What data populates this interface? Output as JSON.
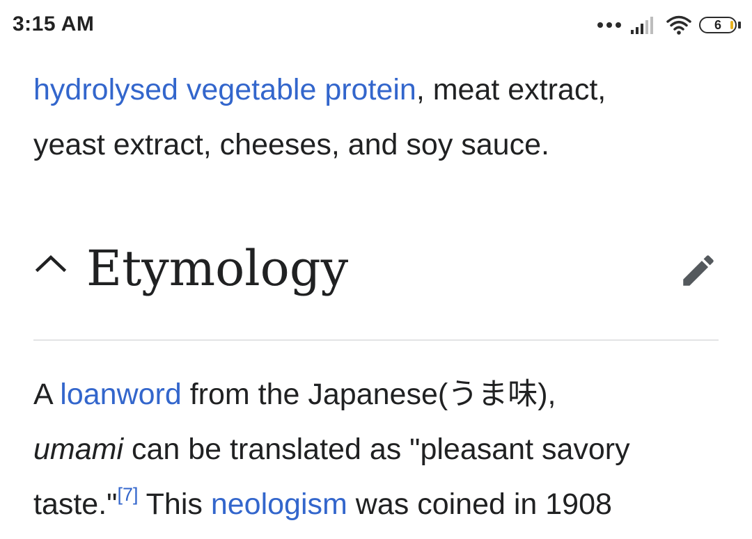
{
  "status_bar": {
    "time": "3:15 AM",
    "battery_level": "6"
  },
  "intro_paragraph": {
    "link_hvp": "hydrolysed vegetable protein",
    "text_1": ", meat extract,",
    "text_2": "yeast extract, cheeses, and soy sauce."
  },
  "etymology_section": {
    "heading": "Etymology",
    "text_a": "A ",
    "link_loanword": "loanword",
    "text_b": " from the Japanese(うま味),",
    "italic_umami": "umami",
    "text_c": " can be translated as \"pleasant savory",
    "text_d": "taste.\"",
    "ref_7": "[7]",
    "text_e": " This ",
    "link_neologism": "neologism",
    "text_f": " was coined in 1908"
  },
  "icons": {
    "chevron": "chevron-up-icon",
    "edit": "pencil-edit-icon",
    "signal": "cellular-signal-icon",
    "wifi": "wifi-icon",
    "battery": "battery-icon",
    "more": "more-dots-icon"
  },
  "colors": {
    "link": "#3366cc",
    "text": "#202122",
    "divider": "#e2e3e5",
    "icon_gray": "#54595d"
  }
}
